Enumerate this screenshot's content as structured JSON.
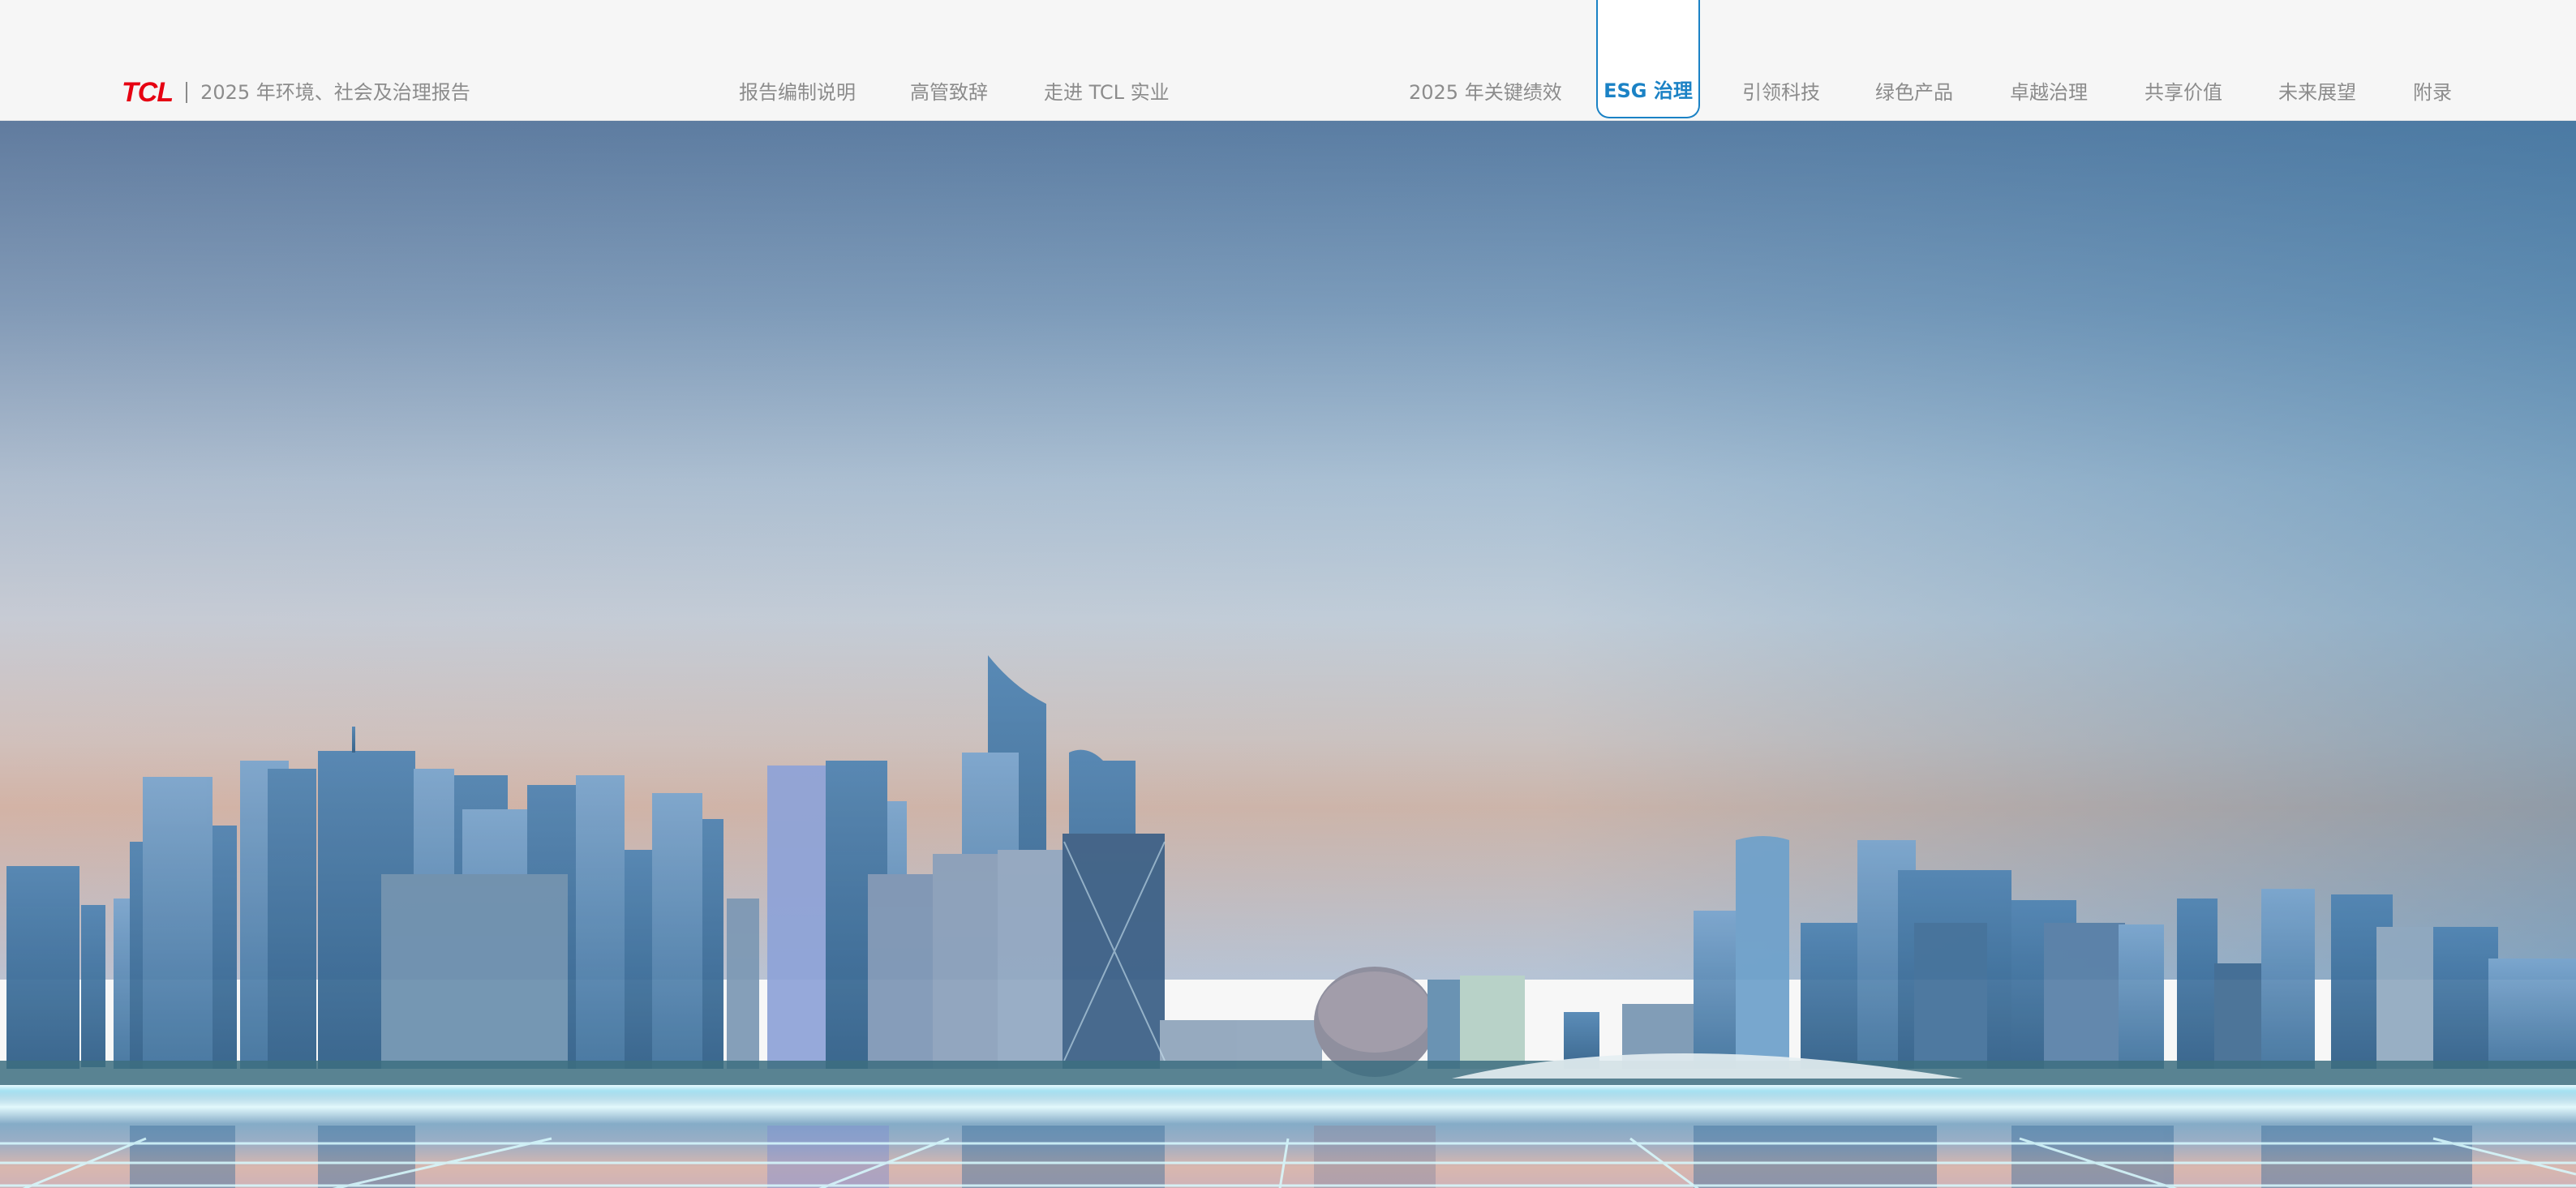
{
  "header": {
    "logo_text": "TCL",
    "report_title": "2025 年环境、社会及治理报告",
    "nav": [
      {
        "label": "报告编制说明"
      },
      {
        "label": "高管致辞"
      },
      {
        "label": "走进 TCL 实业"
      },
      {
        "label": "2025 年关键绩效"
      },
      {
        "label": "ESG 治理",
        "active": true
      },
      {
        "label": "引领科技"
      },
      {
        "label": "绿色产品"
      },
      {
        "label": "卓越治理"
      },
      {
        "label": "共享价值"
      },
      {
        "label": "未来展望"
      },
      {
        "label": "附录"
      }
    ]
  },
  "colors": {
    "brand_red": "#e60012",
    "accent_blue": "#1b82c5",
    "nav_text": "#8c8c8c"
  },
  "hero": {
    "icon": "city-skyline-banner"
  }
}
